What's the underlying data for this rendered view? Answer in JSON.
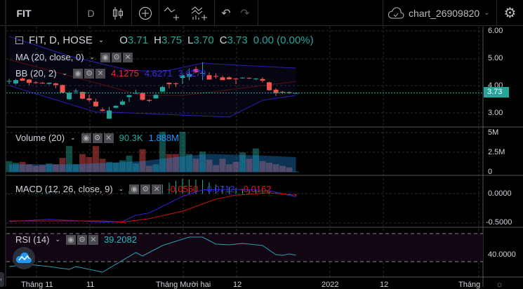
{
  "toolbar": {
    "symbol": "FIT",
    "interval": "D",
    "chart_name": "chart_26909820"
  },
  "legend": {
    "title": "FIT, D, HOSE",
    "o_label": "O",
    "o": "3.71",
    "h_label": "H",
    "h": "3.75",
    "l_label": "L",
    "l": "3.70",
    "c_label": "C",
    "c": "3.73",
    "change": "0.00 (0.00%)"
  },
  "indicators": {
    "ma": {
      "name": "MA (20, close, 0)"
    },
    "bb": {
      "name": "BB (20, 2)",
      "basis": "4.1275",
      "upper": "4.6271",
      "lower": "3.6279"
    },
    "volume": {
      "name": "Volume (20)",
      "value": "90.3K",
      "ma": "1.888M"
    },
    "macd": {
      "name": "MACD (12, 26, close, 9)",
      "hist": "-0.0550",
      "macd": "-0.0712",
      "signal": "-0.0162"
    },
    "rsi": {
      "name": "RSI (14)",
      "value": "39.2082"
    }
  },
  "price_axis": [
    "6.00",
    "5.00",
    "4.00",
    "3.00"
  ],
  "current_price": "3.73",
  "volume_axis": [
    "5M",
    "2.5M",
    "0"
  ],
  "macd_axis": [
    "0.0000",
    "-0.5000"
  ],
  "rsi_axis": [
    "40.0000"
  ],
  "time_axis": [
    "Tháng 11",
    "11",
    "Tháng Mười hai",
    "12",
    "2022",
    "12",
    "Tháng"
  ],
  "colors": {
    "up": "#26a69a",
    "down": "#ef5350",
    "bb": "#2a1fb5",
    "basis": "#5a1010",
    "macd": "#3322dd",
    "signal": "#cc1111",
    "rsi": "#2a9fb0"
  },
  "chart_data": {
    "type": "candlestick",
    "candles": [
      [
        4.15,
        4.25,
        4.05,
        4.17
      ],
      [
        4.08,
        4.24,
        4.04,
        4.2
      ],
      [
        4.26,
        4.3,
        4.16,
        4.18
      ],
      [
        4.22,
        4.24,
        4.02,
        4.1
      ],
      [
        4.12,
        4.16,
        4.06,
        4.1
      ],
      [
        4.1,
        4.13,
        4.07,
        4.09
      ],
      [
        4.06,
        4.12,
        4.04,
        4.1
      ],
      [
        4.08,
        4.1,
        3.9,
        4.02
      ],
      [
        4.02,
        4.04,
        3.72,
        3.74
      ],
      [
        3.5,
        3.78,
        3.48,
        3.74
      ],
      [
        3.79,
        3.88,
        3.7,
        3.81
      ],
      [
        3.77,
        3.78,
        3.5,
        3.52
      ],
      [
        3.53,
        3.66,
        3.4,
        3.47
      ],
      [
        3.41,
        3.52,
        3.22,
        3.24
      ],
      [
        3.12,
        3.2,
        3.05,
        3.08
      ],
      [
        2.79,
        3.22,
        2.78,
        3.09
      ],
      [
        3.19,
        3.28,
        3.17,
        3.26
      ],
      [
        3.3,
        3.48,
        3.28,
        3.42
      ],
      [
        3.58,
        3.66,
        3.4,
        3.65
      ],
      [
        3.72,
        3.85,
        3.7,
        3.73
      ],
      [
        3.73,
        3.76,
        3.45,
        3.48
      ],
      [
        3.47,
        3.5,
        3.4,
        3.44
      ],
      [
        3.53,
        3.7,
        3.52,
        3.66
      ],
      [
        3.78,
        3.98,
        3.77,
        3.95
      ],
      [
        4.1,
        4.12,
        3.9,
        4.05
      ],
      [
        4.08,
        4.12,
        3.95,
        4.07
      ],
      [
        4.28,
        4.4,
        4.05,
        4.38
      ],
      [
        4.32,
        4.62,
        4.2,
        4.42
      ],
      [
        4.6,
        4.7,
        4.45,
        4.49
      ],
      [
        4.44,
        4.85,
        4.2,
        4.46
      ],
      [
        4.38,
        4.48,
        4.22,
        4.22
      ],
      [
        4.35,
        4.45,
        4.25,
        4.34
      ],
      [
        4.3,
        4.36,
        4.2,
        4.2
      ],
      [
        4.3,
        4.33,
        4.22,
        4.23
      ],
      [
        4.26,
        4.27,
        4.05,
        4.24
      ],
      [
        4.27,
        4.3,
        4.25,
        4.29
      ],
      [
        4.28,
        4.3,
        4.24,
        4.26
      ],
      [
        4.24,
        4.27,
        4.2,
        4.26
      ],
      [
        4.24,
        4.3,
        4.12,
        4.18
      ],
      [
        4.12,
        4.14,
        3.82,
        3.83
      ],
      [
        3.85,
        3.9,
        3.62,
        3.72
      ],
      [
        3.77,
        3.8,
        3.7,
        3.75
      ],
      [
        3.76,
        3.78,
        3.7,
        3.72
      ],
      [
        3.71,
        3.75,
        3.7,
        3.73
      ]
    ],
    "bb_upper": [
      [
        0,
        5.8
      ],
      [
        9,
        5.08
      ],
      [
        18,
        4.56
      ],
      [
        23,
        4.51
      ],
      [
        29,
        4.82
      ],
      [
        34,
        4.75
      ],
      [
        43,
        4.64
      ]
    ],
    "bb_lower": [
      [
        0,
        4.0
      ],
      [
        13,
        3.03
      ],
      [
        15,
        3.03
      ],
      [
        33,
        2.85
      ],
      [
        38,
        3.46
      ],
      [
        43,
        3.64
      ]
    ],
    "bb_basis": [
      [
        0,
        4.95
      ],
      [
        20,
        3.64
      ],
      [
        26,
        3.64
      ],
      [
        43,
        4.15
      ]
    ],
    "volume": [
      1.4,
      1.2,
      1.3,
      1.0,
      0.8,
      0.9,
      1.1,
      1.0,
      1.8,
      3.3,
      1.0,
      2.3,
      1.9,
      3.3,
      1.7,
      1.3,
      1.2,
      1.5,
      2.1,
      1.1,
      2.9,
      0.8,
      1.0,
      5.1,
      2.3,
      2.3,
      5.1,
      2.3,
      1.7,
      2.6,
      1.6,
      0.9,
      1.7,
      1.0,
      1.3,
      2.5,
      1.7,
      3.0,
      1.4,
      1.2,
      1.0,
      0.8,
      0.6,
      0.09
    ],
    "volume_ma": [
      [
        0,
        1.0
      ],
      [
        10,
        1.0
      ],
      [
        20,
        1.4
      ],
      [
        27,
        2.1
      ],
      [
        30,
        2.3
      ],
      [
        38,
        2.1
      ],
      [
        43,
        1.9
      ]
    ],
    "macd": [
      [
        0,
        -0.48
      ],
      [
        6,
        -0.44
      ],
      [
        14,
        -0.49
      ],
      [
        17,
        -0.48
      ],
      [
        19,
        -0.37
      ],
      [
        21,
        -0.33
      ],
      [
        26,
        -0.04
      ],
      [
        29,
        0.07
      ],
      [
        34,
        0.08
      ],
      [
        39,
        0.06
      ],
      [
        43,
        -0.05
      ]
    ],
    "signal": [
      [
        0,
        -0.47
      ],
      [
        14,
        -0.47
      ],
      [
        17,
        -0.49
      ],
      [
        21,
        -0.43
      ],
      [
        26,
        -0.3
      ],
      [
        31,
        -0.09
      ],
      [
        34,
        -0.02
      ],
      [
        39,
        0.02
      ],
      [
        43,
        -0.02
      ]
    ],
    "rsi": [
      [
        0,
        23
      ],
      [
        3,
        26
      ],
      [
        6,
        23
      ],
      [
        9,
        19
      ],
      [
        10,
        23
      ],
      [
        14,
        15
      ],
      [
        19,
        43
      ],
      [
        20,
        38
      ],
      [
        23,
        53
      ],
      [
        27,
        65
      ],
      [
        29,
        65
      ],
      [
        31,
        55
      ],
      [
        33,
        54
      ],
      [
        35,
        56
      ],
      [
        38,
        53
      ],
      [
        40,
        40
      ],
      [
        41,
        39
      ],
      [
        42,
        41
      ],
      [
        43,
        39.2
      ]
    ],
    "rsi_levels": [
      70,
      30
    ],
    "ylim_price": [
      2.5,
      6.2
    ]
  }
}
